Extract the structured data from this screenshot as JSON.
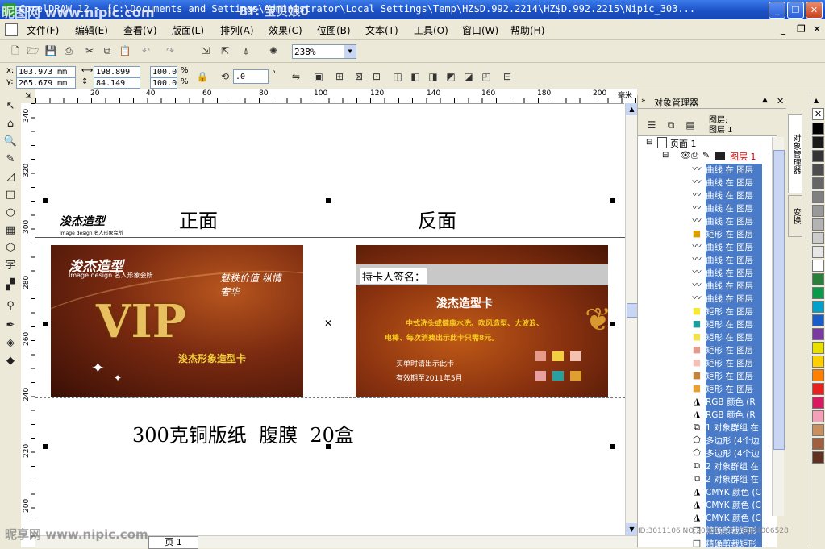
{
  "titlebar": {
    "title": "CorelDRAW 12 - [C:\\Documents and Settings\\Administrator\\Local Settings\\Temp\\HZ$D.992.2214\\HZ$D.992.2215\\Nipic_303...",
    "watermark_left": "昵图网 www.nipic.com",
    "watermark_by": "BY: 宝贝娘0",
    "buttons": [
      "minimize",
      "restore",
      "close"
    ]
  },
  "menubar": {
    "items": [
      "文件(F)",
      "编辑(E)",
      "查看(V)",
      "版面(L)",
      "排列(A)",
      "效果(C)",
      "位图(B)",
      "文本(T)",
      "工具(O)",
      "窗口(W)",
      "帮助(H)"
    ]
  },
  "toolbar": {
    "zoom_value": "238%"
  },
  "propertybar": {
    "x_label": "x:",
    "x_value": "103.973 mm",
    "y_label": "y:",
    "y_value": "265.679 mm",
    "w_value": "198.899 mm",
    "h_value": "84.149 mm",
    "scale_x": "100.0",
    "scale_y": "100.0",
    "pct1": "%",
    "pct2": "%",
    "rotation_value": ".0",
    "deg": "°"
  },
  "rulers": {
    "h_unit": "毫米",
    "h_ticks": [
      "20",
      "40",
      "60",
      "80",
      "100",
      "120",
      "140",
      "160",
      "180",
      "200"
    ],
    "v_ticks": [
      "340",
      "320",
      "300",
      "280",
      "260",
      "240",
      "220",
      "200"
    ]
  },
  "canvas": {
    "front_label": "正面",
    "back_label": "反面",
    "footer_text": "300克铜版纸  腹膜  20盒",
    "logo_text": "浚杰造型",
    "logo_sub": "Image design  名人形象会所",
    "front_card": {
      "logo": "浚杰造型",
      "logo_sub": "Image design 名人形象会所",
      "slogan": "魅秩价值 纵情奢华",
      "vip": "VIP",
      "card_name": "浚杰形象造型卡"
    },
    "back_card": {
      "signature_label": "持卡人签名：",
      "title": "浚杰造型卡",
      "line1": "中式洗头或健康水洗、吹风造型、大波浪、",
      "line2": "电棒、每次消费出示此卡只需8元。",
      "note1": "买单时请出示此卡",
      "note2": "有效期至2011年5月"
    },
    "page_tab": "页 1"
  },
  "object_manager": {
    "title": "对象管理器",
    "layer_label": "图层:",
    "layer_value": "图层 1",
    "page": "页面 1",
    "layer": "图层 1",
    "side_tabs": [
      "对象管理器",
      "变换"
    ],
    "objects": [
      {
        "label": "曲线 在 图层",
        "icon": "curve-icon"
      },
      {
        "label": "曲线 在 图层",
        "icon": "curve-icon"
      },
      {
        "label": "曲线 在 图层",
        "icon": "curve-icon"
      },
      {
        "label": "曲线 在 图层",
        "icon": "curve-icon"
      },
      {
        "label": "曲线 在 图层",
        "icon": "curve-icon"
      },
      {
        "label": "矩形 在 图层",
        "icon": "rect-icon",
        "color": "#d9a000"
      },
      {
        "label": "曲线 在 图层",
        "icon": "curve-icon"
      },
      {
        "label": "曲线 在 图层",
        "icon": "curve-icon"
      },
      {
        "label": "曲线 在 图层",
        "icon": "curve-icon"
      },
      {
        "label": "曲线 在 图层",
        "icon": "curve-icon"
      },
      {
        "label": "曲线 在 图层",
        "icon": "curve-icon"
      },
      {
        "label": "矩形 在 图层",
        "icon": "rect-icon",
        "color": "#f4e83c"
      },
      {
        "label": "矩形 在 图层",
        "icon": "rect-icon",
        "color": "#1e9e9a"
      },
      {
        "label": "矩形 在 图层",
        "icon": "rect-icon",
        "color": "#f0e24a"
      },
      {
        "label": "矩形 在 图层",
        "icon": "rect-icon",
        "color": "#e49a8c"
      },
      {
        "label": "矩形 在 图层",
        "icon": "rect-icon",
        "color": "#f2c0b4"
      },
      {
        "label": "矩形 在 图层",
        "icon": "rect-icon",
        "color": "#c4823a"
      },
      {
        "label": "矩形 在 图层",
        "icon": "rect-icon",
        "color": "#e8a030"
      },
      {
        "label": "RGB 颜色 (R",
        "icon": "fill-icon"
      },
      {
        "label": "RGB 颜色 (R",
        "icon": "fill-icon"
      },
      {
        "label": "1 对象群组 在",
        "icon": "group-icon"
      },
      {
        "label": "多边形 (4个边",
        "icon": "polygon-icon"
      },
      {
        "label": "多边形 (4个边",
        "icon": "polygon-icon"
      },
      {
        "label": "2 对象群组 在",
        "icon": "group-icon"
      },
      {
        "label": "2 对象群组 在",
        "icon": "group-icon"
      },
      {
        "label": "CMYK 颜色 (C",
        "icon": "fill-icon"
      },
      {
        "label": "CMYK 颜色 (C",
        "icon": "fill-icon"
      },
      {
        "label": "CMYK 颜色 (C",
        "icon": "fill-icon"
      },
      {
        "label": "精确剪裁矩形",
        "icon": "rect-outline-icon"
      },
      {
        "label": "精确剪裁矩形",
        "icon": "rect-outline-icon"
      }
    ],
    "footer_id": "ID:3011106 NO:20101029170834006528"
  },
  "watermark_bottom": "昵享网 www.nipic.com",
  "palette": [
    "#000000",
    "#1a1a1a",
    "#333333",
    "#4d4d4d",
    "#666666",
    "#808080",
    "#999999",
    "#b3b3b3",
    "#cccccc",
    "#e6e6e6",
    "#ffffff",
    "#2a7f3a",
    "#0a9a4a",
    "#00a0c8",
    "#1a5cc8",
    "#7a3aa0",
    "#e8e000",
    "#ffd000",
    "#ff8000",
    "#e82020",
    "#d81b60",
    "#f4a0b8",
    "#c89060",
    "#a06040",
    "#603020"
  ]
}
